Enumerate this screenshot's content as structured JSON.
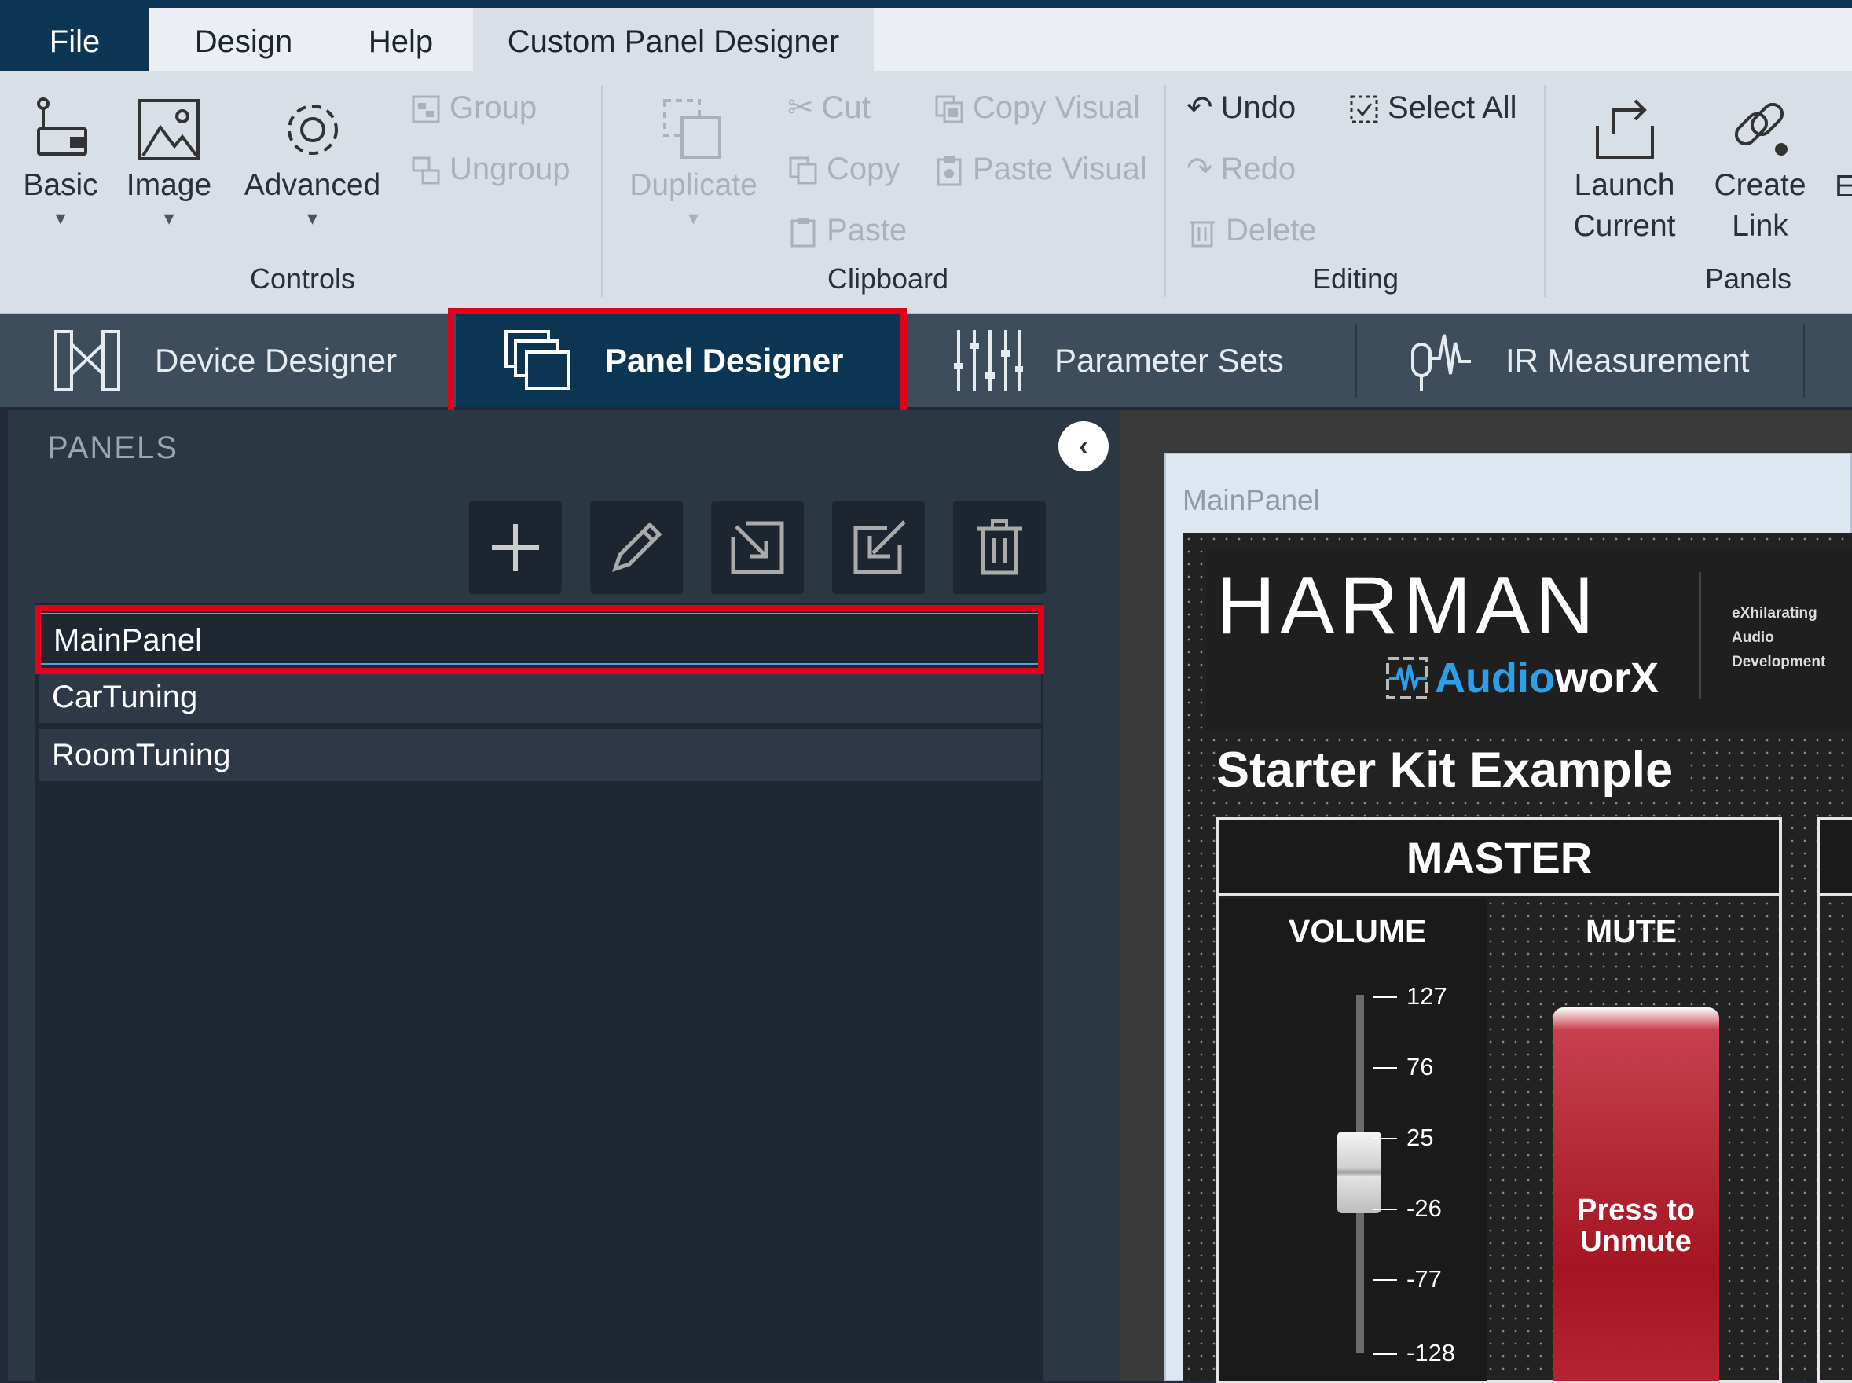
{
  "ribbon_tabs": [
    "File",
    "Design",
    "Help",
    "Custom Panel Designer"
  ],
  "ribbon": {
    "controls": {
      "group": "Controls",
      "basic": "Basic",
      "image": "Image",
      "advanced": "Advanced",
      "group_btn": "Group",
      "ungroup_btn": "Ungroup"
    },
    "clipboard": {
      "group": "Clipboard",
      "duplicate": "Duplicate",
      "cut": "Cut",
      "copy": "Copy",
      "paste": "Paste",
      "copy_visual": "Copy Visual",
      "paste_visual": "Paste Visual"
    },
    "editing": {
      "group": "Editing",
      "undo": "Undo",
      "redo": "Redo",
      "delete": "Delete",
      "select_all": "Select All"
    },
    "panels": {
      "group": "Panels",
      "launch_l1": "Launch",
      "launch_l2": "Current",
      "link_l1": "Create",
      "link_l2": "Link",
      "cut_off": "E"
    }
  },
  "nav_tabs": [
    "Device Designer",
    "Panel Designer",
    "Parameter Sets",
    "IR Measurement"
  ],
  "left_panel": {
    "title": "PANELS",
    "items": [
      "MainPanel",
      "CarTuning",
      "RoomTuning"
    ]
  },
  "canvas": {
    "window_title": "MainPanel",
    "brand": "HARMAN",
    "product_a": "Audio",
    "product_b": "worX",
    "tagline": [
      "eXhilarating",
      "Audio",
      "Development"
    ],
    "heading": "Starter Kit Example",
    "section": "MASTER",
    "volume_label": "VOLUME",
    "mute_label": "MUTE",
    "volume_ticks": [
      "127",
      "76",
      "25",
      "-26",
      "-77",
      "-128"
    ],
    "mute_button_l1": "Press to",
    "mute_button_l2": "Unmute"
  },
  "colors": {
    "accent": "#0b3553",
    "highlight": "#e3001b",
    "brand_blue": "#2f9ee8",
    "mute_red": "#b8313d"
  }
}
